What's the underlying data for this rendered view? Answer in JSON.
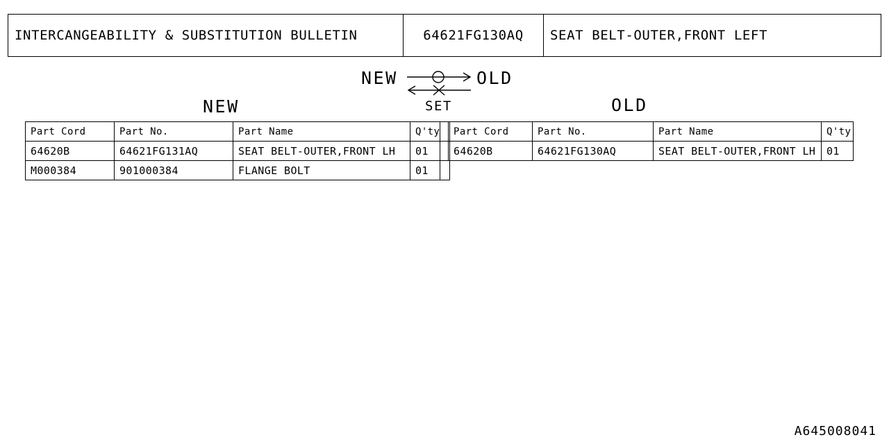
{
  "header": {
    "title": "INTERCANGEABILITY & SUBSTITUTION BULLETIN",
    "part_no": "64621FG130AQ",
    "part_name": "SEAT BELT-OUTER,FRONT LEFT"
  },
  "legend": {
    "new_label": "NEW",
    "old_label": "OLD",
    "set_label": "SET",
    "forward_symbol": "circle",
    "reverse_symbol": "cross"
  },
  "sections": {
    "new_label": "NEW",
    "old_label": "OLD"
  },
  "columns": {
    "part_cord": "Part Cord",
    "part_no": "Part No.",
    "part_name": "Part Name",
    "qty": "Q'ty"
  },
  "new_table": {
    "rows": [
      {
        "part_cord": "64620B",
        "part_no": "64621FG131AQ",
        "part_name": "SEAT BELT-OUTER,FRONT LH",
        "qty": "01"
      },
      {
        "part_cord": "M000384",
        "part_no": "901000384",
        "part_name": "FLANGE BOLT",
        "qty": "01"
      }
    ]
  },
  "old_table": {
    "rows": [
      {
        "part_cord": "64620B",
        "part_no": "64621FG130AQ",
        "part_name": "SEAT BELT-OUTER,FRONT LH",
        "qty": "01"
      }
    ]
  },
  "footer": {
    "drawing_code": "A645008041"
  },
  "colors": {
    "line": "#000000",
    "background": "#ffffff"
  }
}
